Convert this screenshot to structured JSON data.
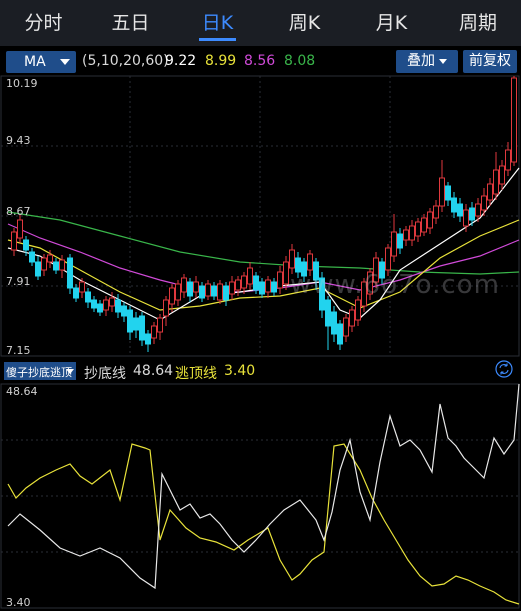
{
  "tabs": [
    {
      "label": "分时"
    },
    {
      "label": "五日"
    },
    {
      "label": "日K",
      "active": true
    },
    {
      "label": "周K"
    },
    {
      "label": "月K"
    },
    {
      "label": "周期"
    }
  ],
  "ma_bar": {
    "selector": "MA",
    "params": "(5,10,20,60)",
    "values": [
      {
        "value": "9.22",
        "color": "#ffffff"
      },
      {
        "value": "8.99",
        "color": "#e8e23a"
      },
      {
        "value": "8.56",
        "color": "#d04ad8"
      },
      {
        "value": "8.08",
        "color": "#39b54a"
      }
    ],
    "overlay_button": "叠加",
    "adjust_button": "前复权"
  },
  "price_axis": {
    "labels": [
      "10.19",
      "9.43",
      "8.67",
      "7.91",
      "7.15"
    ]
  },
  "indicator": {
    "selector": "傻子抄底逃顶",
    "line1_label": "抄底线",
    "line1_value": "48.64",
    "line2_label": "逃顶线",
    "line2_value": "3.40",
    "axis_top": "48.64",
    "axis_bottom": "3.40"
  },
  "watermark": "www.6o7o.com",
  "colors": {
    "up": "#e0393e",
    "down": "#22d3ee",
    "ma5": "#ffffff",
    "ma10": "#e8e23a",
    "ma20": "#d04ad8",
    "ma60": "#39b54a",
    "accent": "#3d8bff"
  }
}
